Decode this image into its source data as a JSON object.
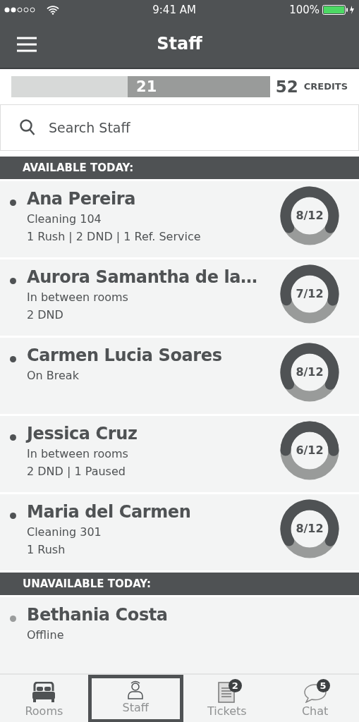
{
  "status_bar": {
    "time": "9:41 AM",
    "battery": "100%"
  },
  "header": {
    "title": "Staff"
  },
  "credits": {
    "used": "21",
    "level": 0.55,
    "total": "52",
    "unit": "CREDITS"
  },
  "search": {
    "placeholder": "Search Staff"
  },
  "sections": [
    {
      "title": "AVAILABLE TODAY:",
      "available": true,
      "staff": [
        {
          "name": "Ana Pereira",
          "status": "Cleaning 104",
          "details": "1 Rush | 2 DND | 1 Ref. Service",
          "progress": "8/12",
          "level": 0.667
        },
        {
          "name": "Aurora Samantha de la…",
          "status": "In between rooms",
          "details": "2 DND",
          "progress": "7/12",
          "level": 0.583
        },
        {
          "name": "Carmen Lucia Soares",
          "status": "On Break",
          "progress": "8/12",
          "level": 0.667
        },
        {
          "name": "Jessica Cruz",
          "status": "In between rooms",
          "details": "2 DND | 1 Paused",
          "progress": "6/12",
          "level": 0.5
        },
        {
          "name": "Maria del Carmen",
          "status": "Cleaning 301",
          "details": "1 Rush",
          "progress": "8/12",
          "level": 0.667
        }
      ]
    },
    {
      "title": "UNAVAILABLE TODAY:",
      "available": false,
      "staff": [
        {
          "name": "Bethania Costa",
          "status": "Offline"
        }
      ]
    }
  ],
  "tabs": [
    {
      "label": "Rooms",
      "kind": "bed",
      "selected": false
    },
    {
      "label": "Staff",
      "kind": "person",
      "selected": true
    },
    {
      "label": "Tickets",
      "kind": "ticket",
      "badge": "2",
      "selected": false
    },
    {
      "label": "Chat",
      "kind": "chat",
      "badge": "5",
      "selected": false
    }
  ]
}
